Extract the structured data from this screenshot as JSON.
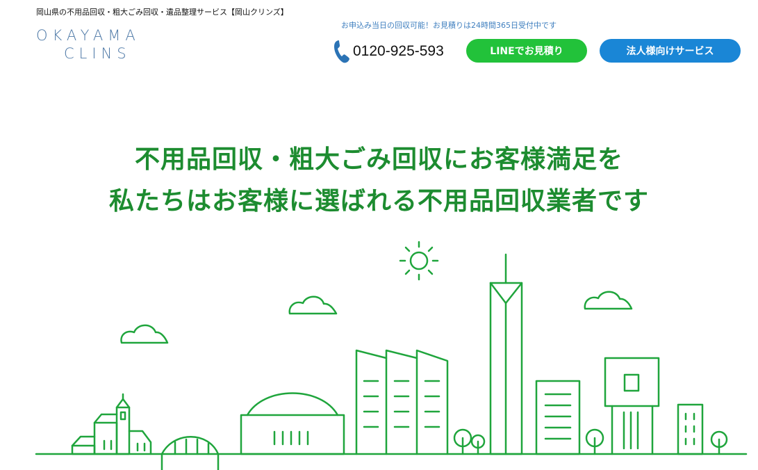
{
  "header": {
    "tagline": "岡山県の不用品回収・粗大ごみ回収・遺品整理サービス【岡山クリンズ】",
    "logo_line1": "OKAYAMA",
    "logo_line2": "CLINS",
    "notice": "お申込み当日の回収可能！お見積りは24時間365日受付中です",
    "phone": "0120-925-593",
    "line_button": "LINEでお見積り",
    "corporate_button": "法人様向けサービス"
  },
  "hero": {
    "headline_line1": "不用品回収・粗大ごみ回収にお客様満足を",
    "headline_line2": "私たちはお客様に選ばれる不用品回収業者です"
  },
  "colors": {
    "brand_green": "#1d8c30",
    "line_green": "#22c23a",
    "corporate_blue": "#1a86d6",
    "logo_blue": "#4e79a7",
    "illustration": "#1fa53c"
  },
  "icons": [
    "phone-icon",
    "sun-icon",
    "cloud-icon"
  ]
}
